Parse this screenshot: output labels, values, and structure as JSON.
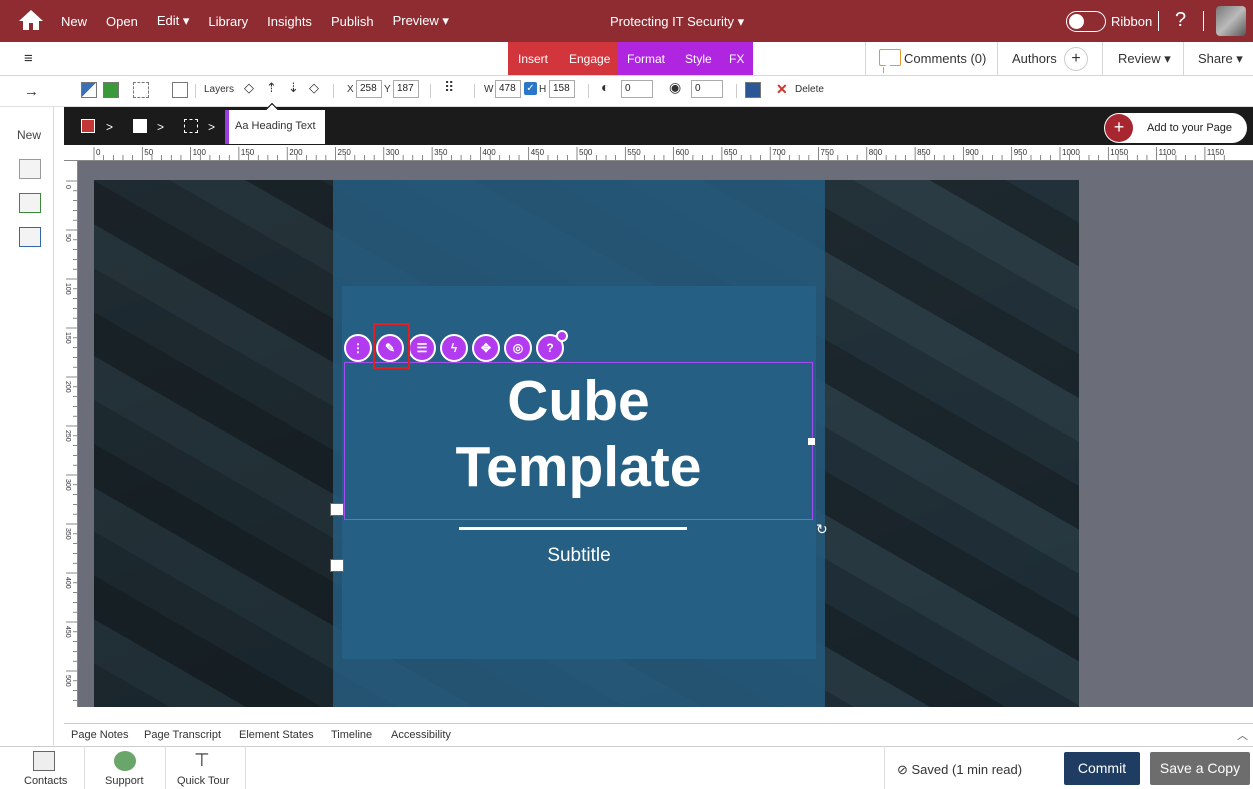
{
  "topbar": {
    "menu": [
      "New",
      "Open",
      "Edit ▾",
      "Library",
      "Insights",
      "Publish",
      "Preview ▾"
    ],
    "doc_title": "Protecting IT Security ▾",
    "ribbon_label": "Ribbon",
    "help": "?"
  },
  "ribbon": {
    "tabs": {
      "insert": "Insert",
      "engage": "Engage",
      "format": "Format",
      "style": "Style",
      "fx": "FX"
    },
    "comments": "Comments (0)",
    "authors": "Authors",
    "review": "Review ▾",
    "share": "Share ▾"
  },
  "toolbar": {
    "layers": "Layers",
    "x_label": "X",
    "x_value": "258",
    "y_label": "Y",
    "y_value": "187",
    "w_label": "W",
    "w_value": "478",
    "h_label": "H",
    "h_value": "158",
    "opacity_value": "0",
    "rotation_value": "0",
    "delete": "Delete"
  },
  "breadcrumb": {
    "heading": "Heading Text",
    "add_page": "Add to your Page"
  },
  "sidebar": {
    "new": "New"
  },
  "canvas": {
    "heading": "Cube Template",
    "subtitle": "Subtitle",
    "accent_color": "#b23bf0"
  },
  "bottom_tabs": [
    "Page Notes",
    "Page Transcript",
    "Element States",
    "Timeline",
    "Accessibility"
  ],
  "footer": {
    "contacts": "Contacts",
    "support": "Support",
    "quick_tour": "Quick Tour",
    "saved": "Saved (1 min read)",
    "commit": "Commit",
    "save_copy": "Save a Copy"
  },
  "ruler": {
    "h_ticks": [
      "0",
      "50",
      "100",
      "150",
      "200",
      "250",
      "300",
      "350",
      "400",
      "450",
      "500",
      "550",
      "600",
      "650",
      "700",
      "750",
      "800",
      "850",
      "900",
      "950",
      "1000",
      "1050",
      "1100",
      "1150"
    ],
    "v_ticks": [
      "0",
      "50",
      "100",
      "150",
      "200",
      "250",
      "300",
      "350",
      "400",
      "450",
      "500"
    ]
  }
}
